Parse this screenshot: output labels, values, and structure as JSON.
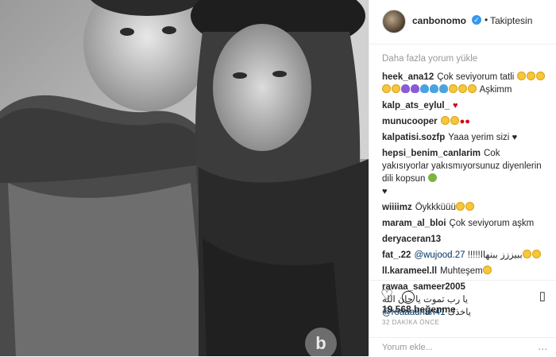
{
  "post": {
    "username": "canbonomo",
    "verified_icon": "verified-badge-icon",
    "separator": "•",
    "follow_status": "Takiptesin"
  },
  "comments_section": {
    "load_more": "Daha fazla yorum yükle",
    "items": [
      {
        "user": "heek_ana12",
        "text": "Çok seviyorum tatli",
        "trail": "Aşkimm"
      },
      {
        "user": "kalp_ats_eylul_",
        "text": ""
      },
      {
        "user": "munucooper",
        "text": ""
      },
      {
        "user": "kalpatisi.sozfp",
        "text": "Yaaa yerim sizi"
      },
      {
        "user": "hepsi_benim_canlarim",
        "text": "Cok yakısıyorlar yakısmıyorsunuz diyenlerin dili kopsun"
      },
      {
        "user": "wiiiimz",
        "text": "Öykkküüü"
      },
      {
        "user": "maram_al_bloi",
        "text": "Çok seviyorum aşkm"
      },
      {
        "user": "deryaceran13",
        "text": ""
      },
      {
        "user": "fat_.22",
        "mention": "@wujood.27",
        "text": "!!!!!ببيززز ببنهاا"
      },
      {
        "user": "ll.karameel.ll",
        "text": "Muhteşem"
      },
      {
        "user": "rawaa_sameer2005",
        "text": "يا رب تموت يا جان الله",
        "mention": "@roaaadnan41",
        "trail": "ياخذك"
      }
    ]
  },
  "actions": {
    "like_icon": "heart-outline-icon",
    "comment_icon": "comment-icon",
    "save_icon": "bookmark-icon"
  },
  "likes": "19.568 beğenme",
  "timestamp": "32 DAKİKA ÖNCE",
  "composer": {
    "placeholder": "Yorum ekle...",
    "menu": "..."
  },
  "watermark": "b"
}
